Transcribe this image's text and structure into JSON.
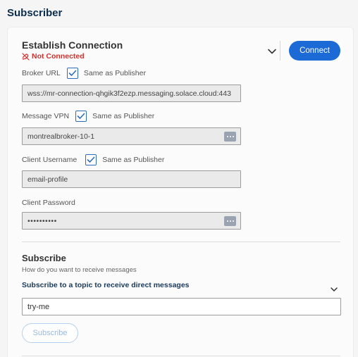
{
  "page": {
    "title": "Subscriber"
  },
  "connection": {
    "title": "Establish Connection",
    "status": "Not Connected",
    "connect_label": "Connect"
  },
  "fields": {
    "broker_url": {
      "label": "Broker URL",
      "checkbox_label": "Same as Publisher",
      "checked": true,
      "value": "wss://mr-connection-qhgik3f2ezp.messaging.solace.cloud:443"
    },
    "message_vpn": {
      "label": "Message VPN",
      "checkbox_label": "Same as Publisher",
      "checked": true,
      "value": "montrealbroker-10-1"
    },
    "client_username": {
      "label": "Client Username",
      "checkbox_label": "Same as Publisher",
      "checked": true,
      "value": "email-profile"
    },
    "client_password": {
      "label": "Client Password",
      "value": "••••••••••"
    }
  },
  "subscribe": {
    "title": "Subscribe",
    "description": "How do you want to receive messages",
    "mode_selected": "Subscribe to a topic to receive direct messages",
    "topic_value": "try-me",
    "button_label": "Subscribe"
  },
  "icons": {
    "status": "broken-link-icon",
    "collapse": "chevron-down-icon",
    "reveal": "more-dots-icon",
    "checkbox": "check-icon"
  },
  "colors": {
    "accent": "#1b6ad6",
    "status_error": "#d0312d",
    "heading": "#0b2e4f"
  }
}
